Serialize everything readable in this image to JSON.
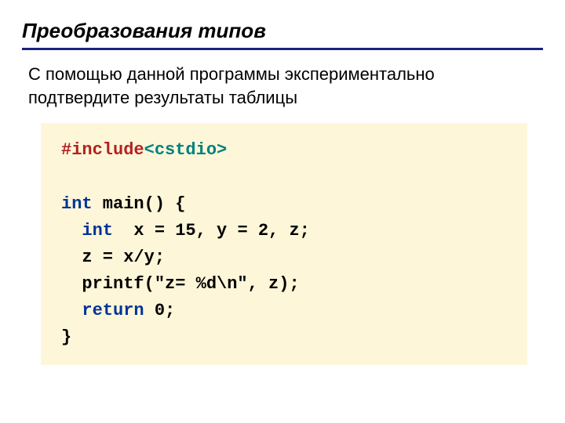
{
  "title": "Преобразования типов",
  "subtitle": "С помощью данной программы экспериментально подтвердите результаты таблицы",
  "code": {
    "include_kw": "#include",
    "include_hdr": "<cstdio>",
    "int_kw": "int",
    "main_sig": " main() {",
    "decl_rest": "  x = 15, y = 2, z;",
    "assign": "  z = x/y;",
    "printf": "  printf(\"z= %d\\n\", z);",
    "return_kw": "return",
    "return_rest": " 0;",
    "close": "}"
  }
}
